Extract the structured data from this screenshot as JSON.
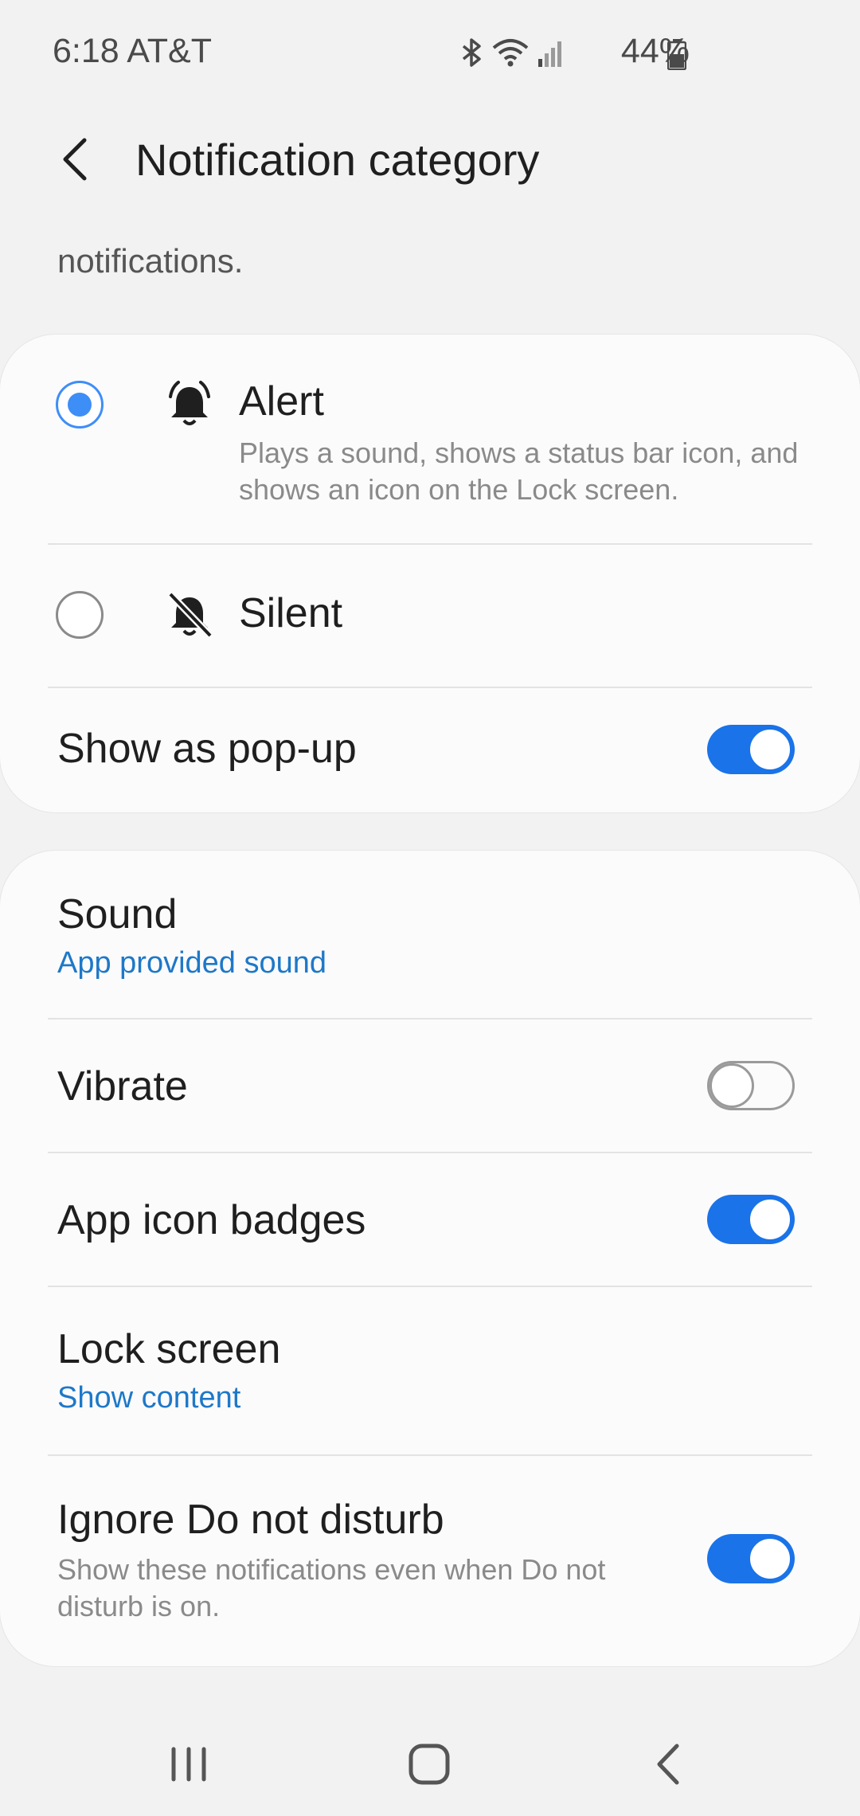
{
  "status_bar": {
    "time_carrier": "6:18 AT&T",
    "battery": "44%",
    "icons": [
      "bluetooth-icon",
      "wifi-icon",
      "signal-icon",
      "battery-icon"
    ]
  },
  "header": {
    "title": "Notification category",
    "back_icon": "chevron-left-icon"
  },
  "description_tail": "notifications.",
  "card1": {
    "alert": {
      "label": "Alert",
      "description": "Plays a sound, shows a status bar icon, and shows an icon on the Lock screen.",
      "selected": true
    },
    "silent": {
      "label": "Silent",
      "selected": false
    },
    "popup": {
      "label": "Show as pop-up",
      "enabled": true
    }
  },
  "card2": {
    "sound": {
      "label": "Sound",
      "value": "App provided sound"
    },
    "vibrate": {
      "label": "Vibrate",
      "enabled": false
    },
    "badges": {
      "label": "App icon badges",
      "enabled": true
    },
    "lock_screen": {
      "label": "Lock screen",
      "value": "Show content"
    },
    "dnd": {
      "label": "Ignore Do not disturb",
      "description": "Show these notifications even when Do not disturb is on.",
      "enabled": true
    }
  },
  "colors": {
    "accent": "#1a73e8",
    "radio_selected": "#3e8ef7",
    "link_blue": "#1e78c8",
    "background": "#f2f2f2"
  },
  "nav_bar": {
    "icons": [
      "recents-icon",
      "home-icon",
      "back-icon"
    ]
  }
}
